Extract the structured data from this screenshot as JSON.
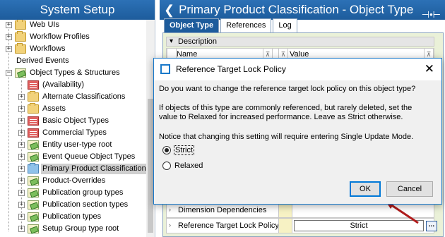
{
  "left_panel": {
    "title": "System Setup",
    "tree": [
      {
        "label": "Web UIs",
        "icon": "folder",
        "expander": "+"
      },
      {
        "label": "Workflow Profiles",
        "icon": "folder",
        "expander": "+"
      },
      {
        "label": "Workflows",
        "icon": "folder",
        "expander": "+"
      },
      {
        "label": "Derived Events",
        "icon": "none",
        "expander": ""
      },
      {
        "label": "Object Types & Structures",
        "icon": "object-type",
        "expander": "−"
      },
      {
        "label": "(Availability)",
        "icon": "red-list",
        "expander": ""
      },
      {
        "label": "Alternate Classifications",
        "icon": "folder",
        "expander": "+"
      },
      {
        "label": "Assets",
        "icon": "folder",
        "expander": "+"
      },
      {
        "label": "Basic Object Types",
        "icon": "red-list",
        "expander": "+"
      },
      {
        "label": "Commercial Types",
        "icon": "red-list",
        "expander": "+"
      },
      {
        "label": "Entity user-type root",
        "icon": "object-type",
        "expander": "+"
      },
      {
        "label": "Event Queue Object Types",
        "icon": "object-type",
        "expander": "+"
      },
      {
        "label": "Primary Product Classification",
        "icon": "blue-folder",
        "expander": "+",
        "selected": true
      },
      {
        "label": "Product-Overrides",
        "icon": "object-type",
        "expander": "+"
      },
      {
        "label": "Publication group types",
        "icon": "object-type",
        "expander": "+"
      },
      {
        "label": "Publication section types",
        "icon": "object-type",
        "expander": "+"
      },
      {
        "label": "Publication types",
        "icon": "object-type",
        "expander": "+"
      },
      {
        "label": "Setup Group type root",
        "icon": "object-type",
        "expander": "+"
      }
    ]
  },
  "right_panel": {
    "title": "Primary Product Classification - Object Type",
    "tabs": [
      {
        "label": "Object Type",
        "active": true
      },
      {
        "label": "References",
        "active": false
      },
      {
        "label": "Log",
        "active": false
      }
    ],
    "description_header": "Description",
    "grid_header": {
      "name": "Name",
      "value": "Value"
    },
    "rows": [
      {
        "name": "Dimension Dependencies",
        "value": ""
      },
      {
        "name": "Reference Target Lock Policy",
        "value": "Strict",
        "button": "..."
      }
    ]
  },
  "dialog": {
    "title": "Reference Target Lock Policy",
    "question": "Do you want to change the reference target lock policy on this object type?",
    "explanation": "If objects of this type are commonly referenced, but rarely deleted, set the value to Relaxed for increased performance. Leave as Strict otherwise.",
    "notice": "Notice that changing this setting will require entering Single Update Mode.",
    "options": [
      {
        "label": "Strict",
        "checked": true
      },
      {
        "label": "Relaxed",
        "checked": false
      }
    ],
    "ok_label": "OK",
    "cancel_label": "Cancel",
    "close_glyph": "✕"
  },
  "colors": {
    "titlebar": "#1d5c9c",
    "dialog_border": "#1979ca",
    "annotation_arrow": "#b01c1c"
  }
}
